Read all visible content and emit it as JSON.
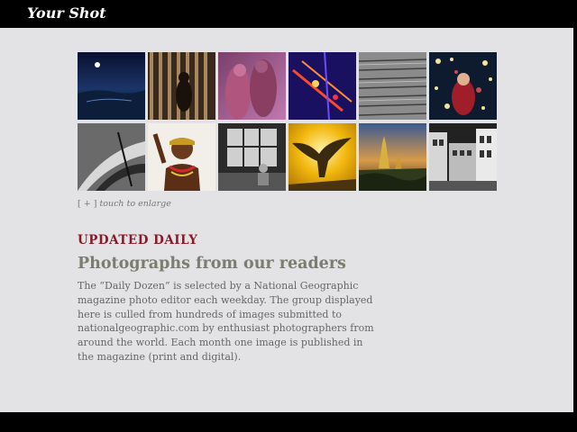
{
  "header": {
    "title": "Your Shot"
  },
  "gallery": {
    "thumbnails": [
      {
        "subject": "moon-over-sea"
      },
      {
        "subject": "dog-shadow-stripes"
      },
      {
        "subject": "women-colored-powder"
      },
      {
        "subject": "ride-lights-night"
      },
      {
        "subject": "aerial-crowd"
      },
      {
        "subject": "child-with-lights"
      },
      {
        "subject": "bw-plant-leaves"
      },
      {
        "subject": "african-girl-beads"
      },
      {
        "subject": "bw-window-person"
      },
      {
        "subject": "eagle-yellow-sky"
      },
      {
        "subject": "temple-sunset"
      },
      {
        "subject": "bw-street-buildings"
      }
    ],
    "enlarge_bracket": "[ + ]",
    "enlarge_text": "touch to enlarge"
  },
  "info": {
    "kicker": "UPDATED DAILY",
    "headline": "Photographs from our readers",
    "description": "The “Daily Dozen” is selected by a National Geographic magazine photo editor each weekday. The group displayed here is culled from hundreds of images submitted to nationalgeographic.com by enthusiast photographers from around the world. Each month one image is published in the magazine (print and digital)."
  }
}
